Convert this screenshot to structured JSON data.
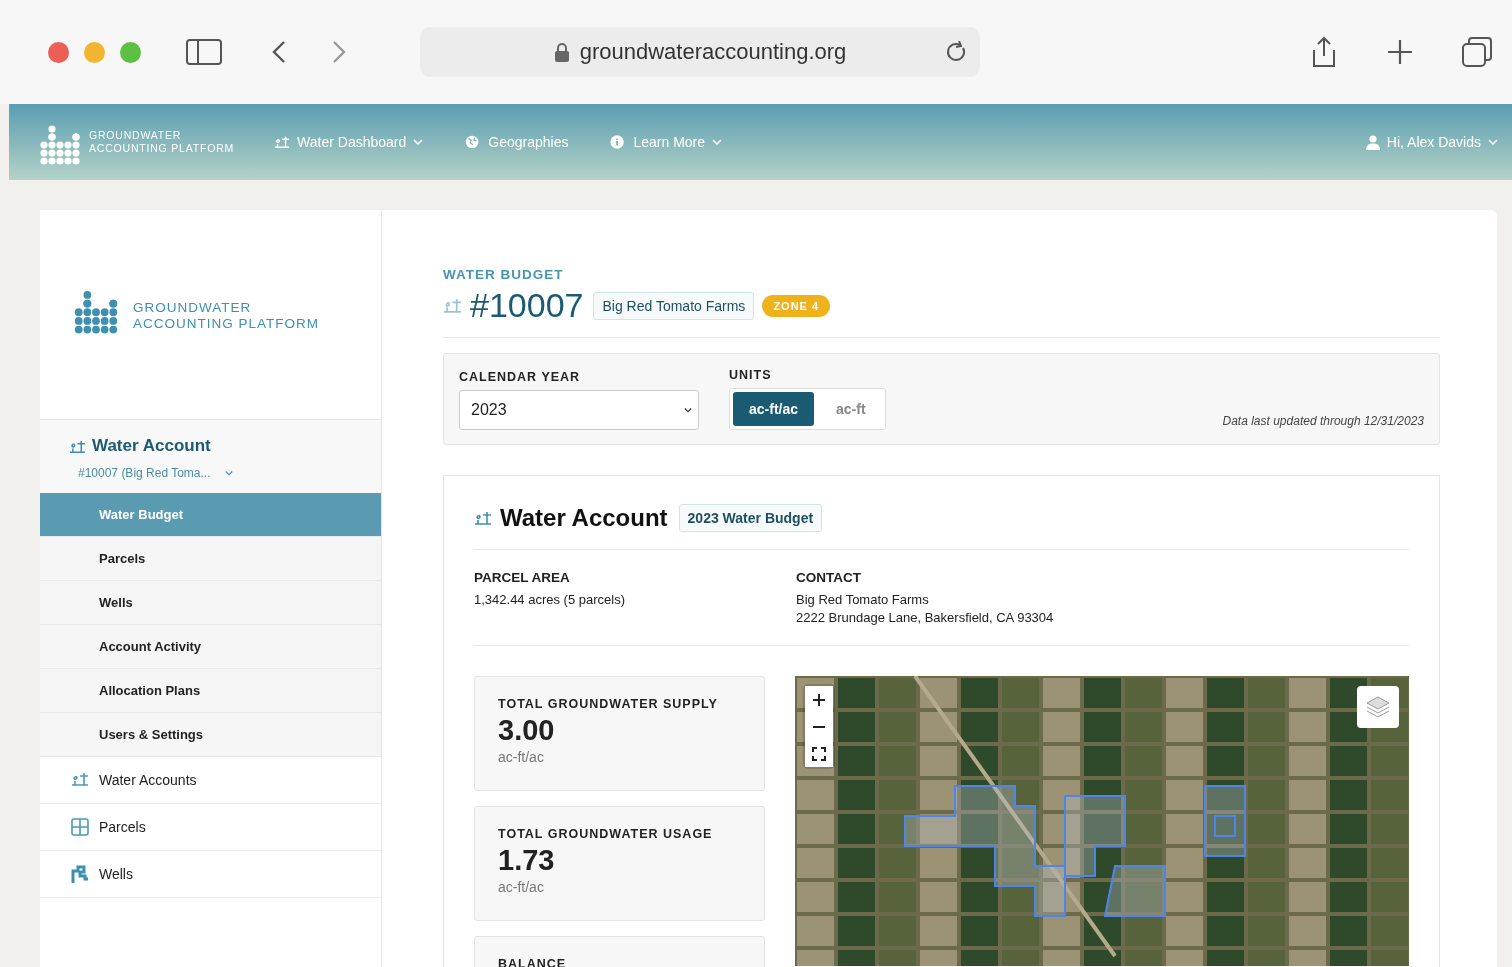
{
  "browser": {
    "url": "groundwateraccounting.org"
  },
  "navbar": {
    "logo_lines": [
      "GROUNDWATER",
      "ACCOUNTING PLATFORM"
    ],
    "items": [
      {
        "label": "Water Dashboard",
        "has_menu": true
      },
      {
        "label": "Geographies",
        "has_menu": false
      },
      {
        "label": "Learn More",
        "has_menu": true
      }
    ],
    "user": "Hi, Alex Davids"
  },
  "sidebar": {
    "logo_lines": [
      "GROUNDWATER",
      "ACCOUNTING PLATFORM"
    ],
    "account_title": "Water Account",
    "account_selector": "#10007 (Big Red Toma...",
    "subitems": [
      {
        "label": "Water Budget",
        "selected": true
      },
      {
        "label": "Parcels",
        "selected": false
      },
      {
        "label": "Wells",
        "selected": false
      },
      {
        "label": "Account Activity",
        "selected": false
      },
      {
        "label": "Allocation Plans",
        "selected": false
      },
      {
        "label": "Users & Settings",
        "selected": false
      }
    ],
    "items": [
      {
        "label": "Water Accounts"
      },
      {
        "label": "Parcels"
      },
      {
        "label": "Wells"
      }
    ]
  },
  "header": {
    "eyebrow": "WATER BUDGET",
    "account_number": "#10007",
    "account_name": "Big Red Tomato Farms",
    "zone": "ZONE 4"
  },
  "filters": {
    "year_label": "CALENDAR YEAR",
    "year": "2023",
    "units_label": "UNITS",
    "units": [
      {
        "label": "ac-ft/ac",
        "selected": true
      },
      {
        "label": "ac-ft",
        "selected": false
      }
    ],
    "updated_note": "Data last updated through 12/31/2023"
  },
  "account_card": {
    "title": "Water Account",
    "badge": "2023 Water Budget",
    "parcel_area_label": "PARCEL AREA",
    "parcel_area": "1,342.44 acres (5 parcels)",
    "contact_label": "CONTACT",
    "contact_lines": [
      "Big Red Tomato Farms",
      "2222 Brundage Lane, Bakersfield, CA 93304"
    ],
    "stats": [
      {
        "label": "TOTAL GROUNDWATER SUPPLY",
        "value": "3.00",
        "unit": "ac-ft/ac"
      },
      {
        "label": "TOTAL GROUNDWATER USAGE",
        "value": "1.73",
        "unit": "ac-ft/ac"
      },
      {
        "label": "BALANCE"
      }
    ]
  }
}
